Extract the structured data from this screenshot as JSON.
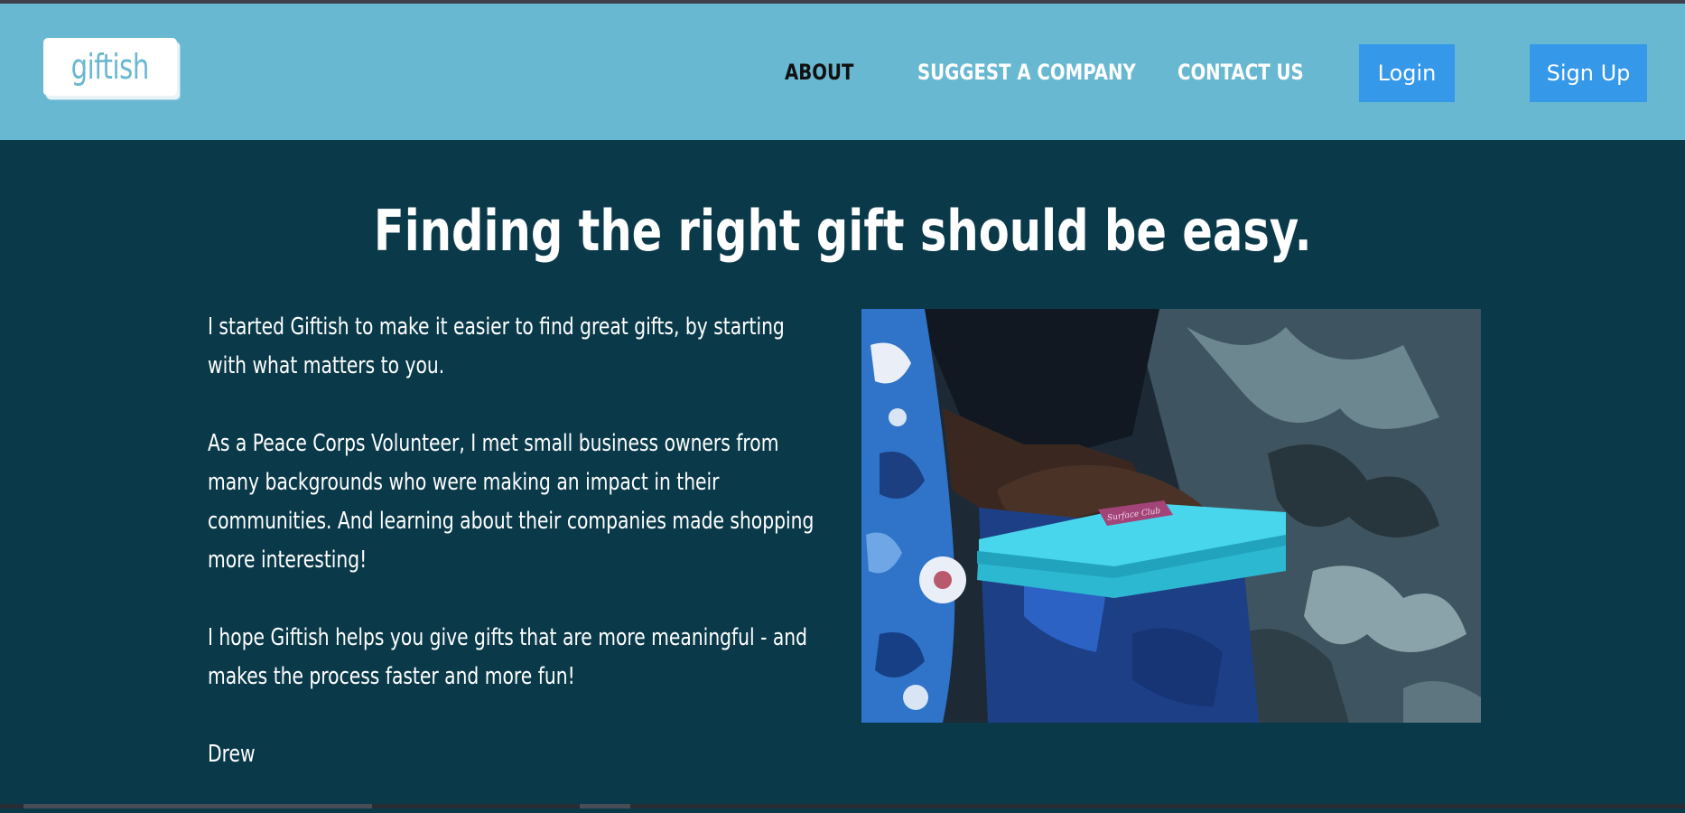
{
  "header": {
    "logo_text": "giftish",
    "nav": [
      {
        "label": "ABOUT",
        "active": true
      },
      {
        "label": "SUGGEST A COMPANY",
        "active": false
      },
      {
        "label": "CONTACT US",
        "active": false
      }
    ],
    "login_label": "Login",
    "signup_label": "Sign Up"
  },
  "main": {
    "title": "Finding the right gift should be easy.",
    "paragraphs": [
      "I started Giftish to make it easier to find great gifts, by starting with what matters to you.",
      "As a Peace Corps Volunteer, I met small business owners from many backgrounds who were making an impact in their communities. And learning about their companies made shopping more interesting!",
      "I hope Giftish helps you give gifts that are more meaningful - and makes the process faster and more fun!",
      "Drew"
    ],
    "image": {
      "label_text": "Surface Club"
    }
  },
  "colors": {
    "header_bg": "#69b8d2",
    "page_bg": "#0a3a4a",
    "button_bg": "#3598e8",
    "gift_box": "#3fd0e6"
  }
}
